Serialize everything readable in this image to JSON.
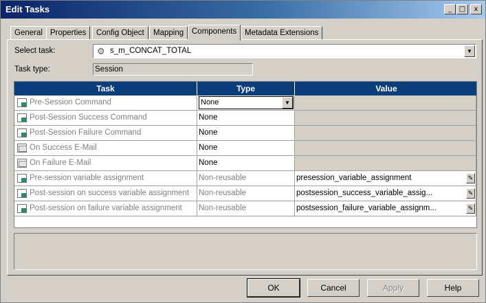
{
  "window": {
    "title": "Edit Tasks",
    "controls": [
      "_",
      "□",
      "x"
    ]
  },
  "tabs": [
    {
      "label": "General"
    },
    {
      "label": "Properties"
    },
    {
      "label": "Config Object"
    },
    {
      "label": "Mapping"
    },
    {
      "label": "Components",
      "active": true
    },
    {
      "label": "Metadata Extensions"
    }
  ],
  "select_task": {
    "label": "Select task:",
    "value": "s_m_CONCAT_TOTAL"
  },
  "task_type": {
    "label": "Task type:",
    "value": "Session"
  },
  "grid": {
    "columns": [
      "Task",
      "Type",
      "Value"
    ],
    "rows": [
      {
        "task": "Pre-Session Command",
        "type": "None",
        "value": "",
        "icon": "command-icon"
      },
      {
        "task": "Post-Session Success Command",
        "type": "None",
        "value": "",
        "icon": "command-icon"
      },
      {
        "task": "Post-Session Failure Command",
        "type": "None",
        "value": "",
        "icon": "command-icon"
      },
      {
        "task": "On Success E-Mail",
        "type": "None",
        "value": "",
        "icon": "email-icon"
      },
      {
        "task": "On Failure E-Mail",
        "type": "None",
        "value": "",
        "icon": "email-icon"
      },
      {
        "task": "Pre-session variable assignment",
        "type": "Non-reusable",
        "value": "presession_variable_assignment",
        "icon": "command-icon"
      },
      {
        "task": "Post-session on success variable assignment",
        "type": "Non-reusable",
        "value": "postsession_success_variable_assig...",
        "icon": "command-icon"
      },
      {
        "task": "Post-session on failure variable assignment",
        "type": "Non-reusable",
        "value": "postsession_failure_variable_assignm...",
        "icon": "command-icon"
      }
    ]
  },
  "buttons": {
    "ok": "OK",
    "cancel": "Cancel",
    "apply": "Apply",
    "help": "Help"
  },
  "colors": {
    "header_bg": "#0a3d7a",
    "title_bar": "#0a246a",
    "dialog_bg": "#d4d0c8"
  }
}
